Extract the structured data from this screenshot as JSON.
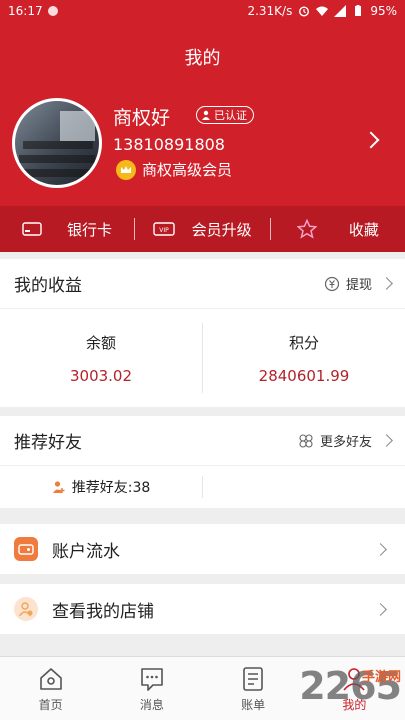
{
  "status_bar": {
    "time": "16:17",
    "network_speed": "2.31K/s",
    "battery": "95%"
  },
  "page": {
    "title": "我的"
  },
  "profile": {
    "username": "商权好",
    "verified_badge": "已认证",
    "phone": "13810891808",
    "member_level": "商权高级会员"
  },
  "quick_actions": [
    {
      "label": "银行卡",
      "icon": "bank-card-icon"
    },
    {
      "label": "会员升级",
      "icon": "vip-card-icon"
    },
    {
      "label": "收藏",
      "icon": "star-icon"
    }
  ],
  "earnings": {
    "title": "我的收益",
    "action": "提现",
    "balance_label": "余额",
    "balance_value": "3003.02",
    "points_label": "积分",
    "points_value": "2840601.99"
  },
  "friends": {
    "title": "推荐好友",
    "action": "更多好友",
    "count_label": "推荐好友:38"
  },
  "menu": [
    {
      "label": "账户流水",
      "icon": "account-flow-icon",
      "color": "#f07b3f"
    },
    {
      "label": "查看我的店铺",
      "icon": "shop-icon",
      "color": "#f4a45a"
    }
  ],
  "tabs": [
    {
      "label": "首页",
      "icon": "home-icon"
    },
    {
      "label": "消息",
      "icon": "message-icon"
    },
    {
      "label": "账单",
      "icon": "bill-icon"
    },
    {
      "label": "我的",
      "icon": "profile-icon",
      "active": true
    }
  ],
  "watermark": {
    "text": "2265",
    "sub": "手游网"
  },
  "colors": {
    "brand_red": "#d0202a",
    "quickbar_red": "#b81a23",
    "value_red": "#b4232a"
  }
}
